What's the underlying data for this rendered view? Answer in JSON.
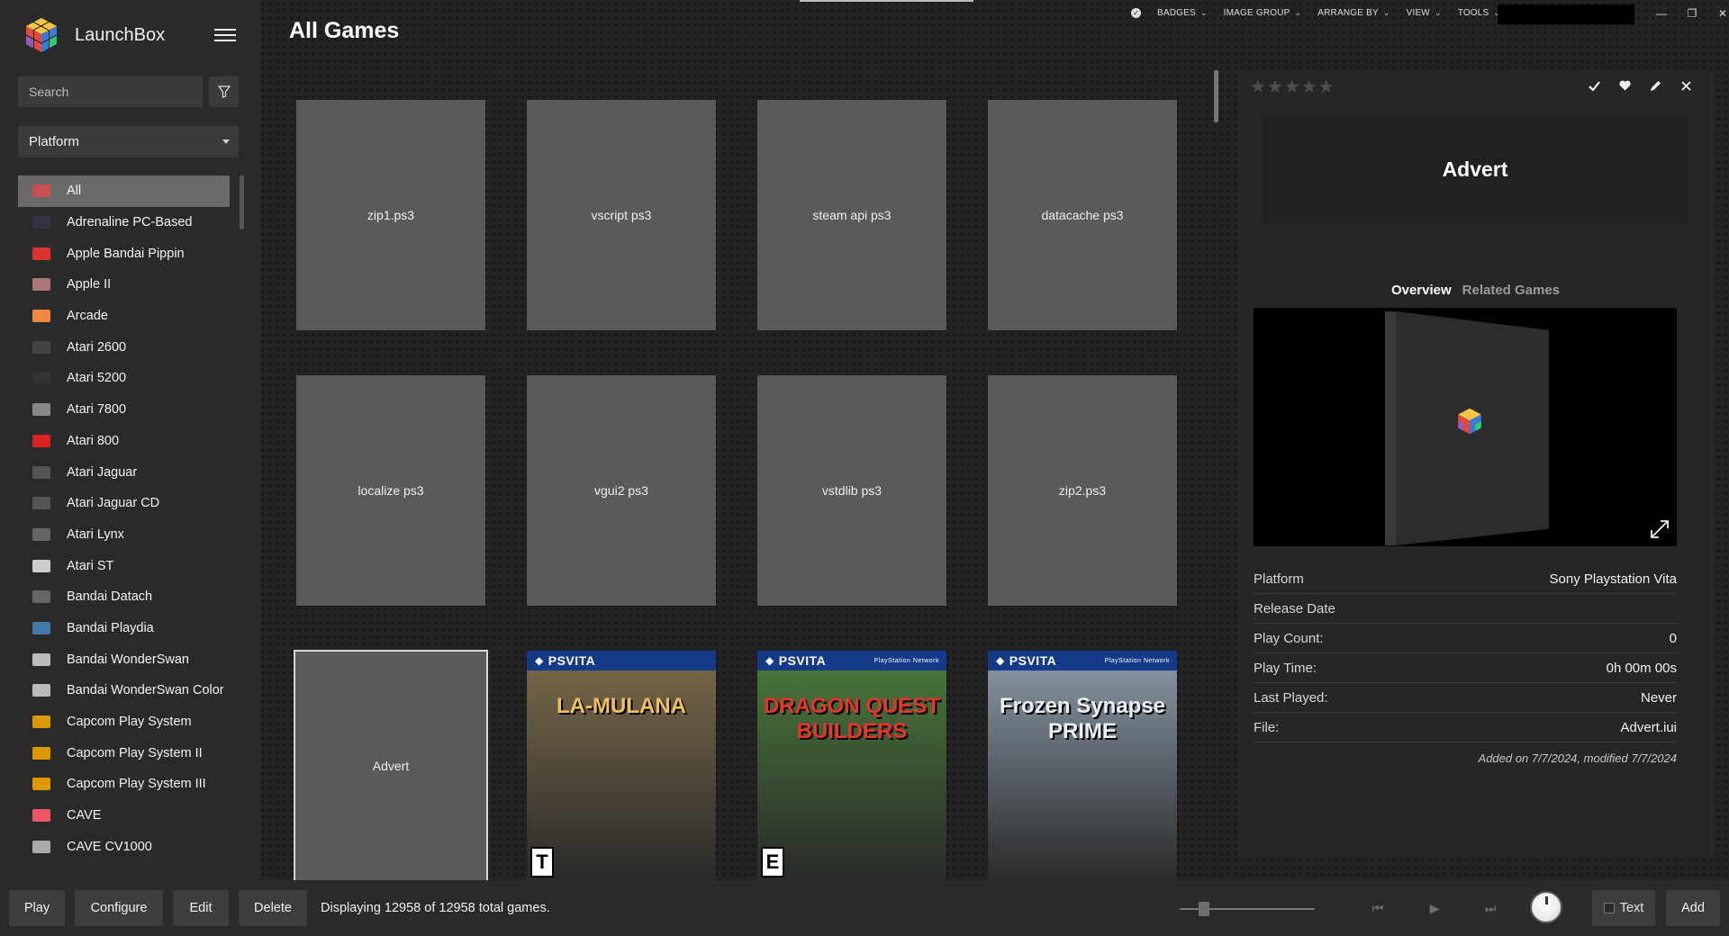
{
  "app": {
    "name": "LaunchBox"
  },
  "search": {
    "placeholder": "Search"
  },
  "platform_select": {
    "value": "Platform"
  },
  "platforms": [
    {
      "label": "All",
      "icon": "all-platforms-icon",
      "color": "#c85050"
    },
    {
      "label": "Adrenaline PC-Based",
      "icon": "adrenaline-icon",
      "color": "#334"
    },
    {
      "label": "Apple Bandai Pippin",
      "icon": "pippin-icon",
      "color": "#d33"
    },
    {
      "label": "Apple II",
      "icon": "apple-ii-icon",
      "color": "#a77"
    },
    {
      "label": "Arcade",
      "icon": "arcade-icon",
      "color": "#e84"
    },
    {
      "label": "Atari 2600",
      "icon": "atari-2600-icon",
      "color": "#444"
    },
    {
      "label": "Atari 5200",
      "icon": "atari-5200-icon",
      "color": "#333"
    },
    {
      "label": "Atari 7800",
      "icon": "atari-7800-icon",
      "color": "#888"
    },
    {
      "label": "Atari 800",
      "icon": "atari-800-icon",
      "color": "#d22"
    },
    {
      "label": "Atari Jaguar",
      "icon": "atari-jaguar-icon",
      "color": "#555"
    },
    {
      "label": "Atari Jaguar CD",
      "icon": "atari-jaguar-cd-icon",
      "color": "#555"
    },
    {
      "label": "Atari Lynx",
      "icon": "atari-lynx-icon",
      "color": "#666"
    },
    {
      "label": "Atari ST",
      "icon": "atari-st-icon",
      "color": "#ccc"
    },
    {
      "label": "Bandai Datach",
      "icon": "bandai-datach-icon",
      "color": "#666"
    },
    {
      "label": "Bandai Playdia",
      "icon": "bandai-playdia-icon",
      "color": "#47a"
    },
    {
      "label": "Bandai WonderSwan",
      "icon": "wonderswan-icon",
      "color": "#bbb"
    },
    {
      "label": "Bandai WonderSwan Color",
      "icon": "wonderswan-color-icon",
      "color": "#bbb"
    },
    {
      "label": "Capcom Play System",
      "icon": "cps-icon",
      "color": "#d90"
    },
    {
      "label": "Capcom Play System II",
      "icon": "cps2-icon",
      "color": "#d90"
    },
    {
      "label": "Capcom Play System III",
      "icon": "cps3-icon",
      "color": "#d90"
    },
    {
      "label": "CAVE",
      "icon": "cave-icon",
      "color": "#e56"
    },
    {
      "label": "CAVE CV1000",
      "icon": "cave-cv1000-icon",
      "color": "#aaa"
    }
  ],
  "page": {
    "title": "All Games"
  },
  "toolbar": {
    "items": [
      "BADGES",
      "IMAGE GROUP",
      "ARRANGE BY",
      "VIEW",
      "TOOLS"
    ]
  },
  "games": [
    {
      "title": "zip1.ps3",
      "type": "placeholder"
    },
    {
      "title": "vscript ps3",
      "type": "placeholder"
    },
    {
      "title": "steam api ps3",
      "type": "placeholder"
    },
    {
      "title": "datacache ps3",
      "type": "placeholder"
    },
    {
      "title": "localize ps3",
      "type": "placeholder"
    },
    {
      "title": "vgui2 ps3",
      "type": "placeholder"
    },
    {
      "title": "vstdlib ps3",
      "type": "placeholder"
    },
    {
      "title": "zip2.ps3",
      "type": "placeholder"
    },
    {
      "title": "Advert",
      "type": "placeholder",
      "selected": true
    },
    {
      "title": "La-Mulana",
      "type": "cover",
      "band": "PSVITA",
      "art": "LA-MULANA",
      "bg": "#7a6a4a",
      "rating": "T"
    },
    {
      "title": "Dragon Quest Builders",
      "type": "cover",
      "band": "PSVITA",
      "psn": "PlayStation Network",
      "art": "DRAGON QUEST BUILDERS",
      "bg": "#4a7a3a",
      "rating": "E"
    },
    {
      "title": "Frozen Synapse Prime",
      "type": "cover",
      "band": "PSVITA",
      "psn": "PlayStation Network",
      "art": "Frozen Synapse PRIME",
      "bg": "#8a9aa8"
    }
  ],
  "details": {
    "title": "Advert",
    "tabs": {
      "overview": "Overview",
      "related": "Related Games"
    },
    "rows": [
      {
        "label": "Platform",
        "value": "Sony Playstation Vita"
      },
      {
        "label": "Release Date",
        "value": ""
      },
      {
        "label": "Play Count:",
        "value": "0"
      },
      {
        "label": "Play Time:",
        "value": "0h 00m 00s"
      },
      {
        "label": "Last Played:",
        "value": "Never"
      },
      {
        "label": "File:",
        "value": "Advert.iui"
      }
    ],
    "added": "Added on 7/7/2024, modified 7/7/2024"
  },
  "bottom": {
    "play": "Play",
    "configure": "Configure",
    "edit": "Edit",
    "delete": "Delete",
    "status": "Displaying 12958 of 12958 total games.",
    "text_toggle": "Text",
    "add": "Add"
  }
}
